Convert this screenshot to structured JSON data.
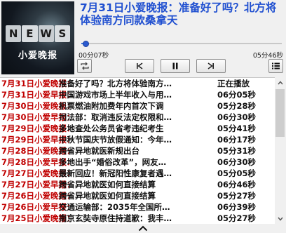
{
  "player": {
    "cover": {
      "news_letters": [
        "N",
        "E",
        "W",
        "S"
      ],
      "subtitle": "小爱晚报"
    },
    "title": "7月31日小爱晚报：准备好了吗？北方将体验南方同款桑拿天",
    "elapsed": "00分07秒",
    "total": "05分46秒",
    "progress": 0.02,
    "controls": {
      "loop_icon": "loop-icon",
      "prev_icon": "skip-previous-icon",
      "pause_icon": "pause-icon",
      "next_icon": "skip-next-icon",
      "playlist_icon": "playlist-menu-icon"
    }
  },
  "playlist": [
    {
      "date": "7月31日小爱晚报：",
      "text": "准备好了吗？北方将体验南方…",
      "dur": "正在播放"
    },
    {
      "date": "7月31日小爱早报：",
      "text": "中国游戏市场上半年收入与用…",
      "dur": "06分05秒"
    },
    {
      "date": "7月30日小爱晚报：",
      "text": "机票燃油附加费年内首次下调",
      "dur": "05分28秒"
    },
    {
      "date": "7月30日小爱早报：",
      "text": "司法部：取消违反法定权限和…",
      "dur": "06分30秒"
    },
    {
      "date": "7月29日小爱晚报：",
      "text": "多地查处公务员省考违纪考生",
      "dur": "05分41秒"
    },
    {
      "date": "7月29日小爱早报：",
      "text": "中秋节国庆节放假通知：今年…",
      "dur": "06分17秒"
    },
    {
      "date": "7月28日小爱晚报：",
      "text": "跨省异地就医新规出台",
      "dur": "05分31秒"
    },
    {
      "date": "7月28日小爱早报：",
      "text": "多地出手“婚俗改革”，网友…",
      "dur": "06分30秒"
    },
    {
      "date": "7月27日小爱晚报：",
      "text": "最新回应！新冠阳性康复者遇…",
      "dur": "05分05秒"
    },
    {
      "date": "7月27日小爱早报：",
      "text": "跨省异地就医如何直接结算",
      "dur": "06分46秒"
    },
    {
      "date": "7月26日小爱晚报：",
      "text": "跨省异地就医如何直接结算",
      "dur": "05分27秒"
    },
    {
      "date": "7月26日小爱早报：",
      "text": "交通运输部：2035年全国所…",
      "dur": "06分39秒"
    },
    {
      "date": "7月25日小爱晚报：",
      "text": "南京玄奘寺原住持道歉：我丰…",
      "dur": "05分27秒"
    }
  ],
  "scrollbar": {
    "up_icon": "scroll-up-arrow-icon",
    "down_icon": "scroll-down-arrow-icon"
  },
  "bottom": {
    "icon": "chevron-up-icon"
  },
  "colors": {
    "title": "#1f4fd0",
    "date": "#c00000",
    "progress": "#3a6fd8"
  }
}
